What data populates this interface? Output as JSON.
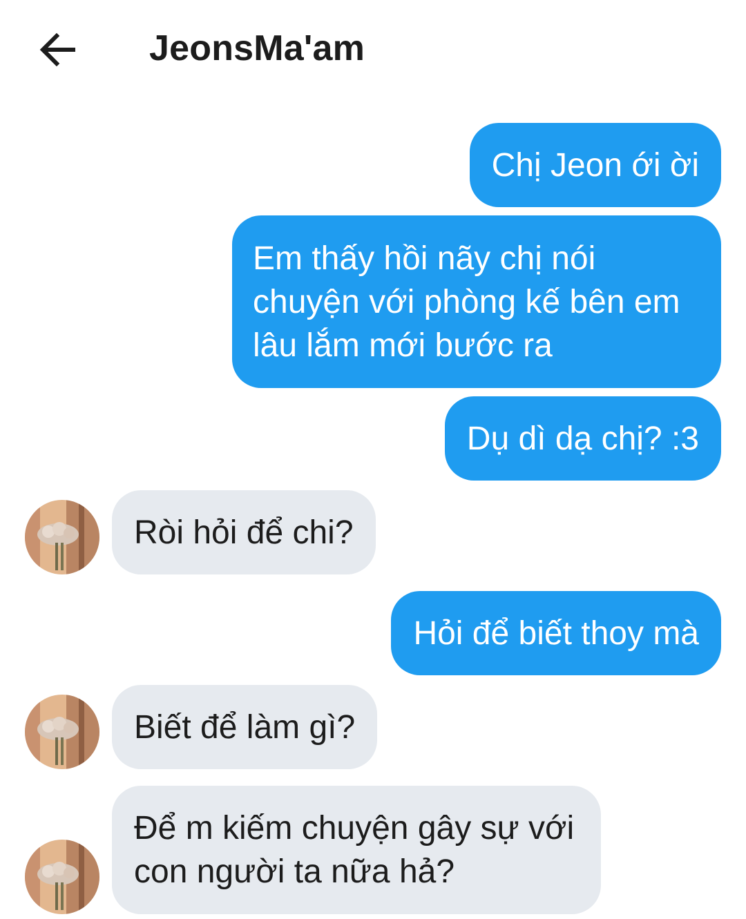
{
  "header": {
    "back_icon": "arrow-left-icon",
    "title": "JeonsMa'am"
  },
  "colors": {
    "outgoing_bubble": "#1f9cf0",
    "incoming_bubble": "#e6eaef",
    "background": "#ffffff"
  },
  "messages": [
    {
      "direction": "outgoing",
      "text": "Chị Jeon ới ời"
    },
    {
      "direction": "outgoing",
      "text": "Em thấy hồi nãy chị nói chuyện với phòng kế bên em lâu lắm mới bước ra"
    },
    {
      "direction": "outgoing",
      "text": "Dụ dì dạ chị? :3"
    },
    {
      "direction": "incoming",
      "text": "Ròi hỏi để chi?"
    },
    {
      "direction": "outgoing",
      "text": "Hỏi để biết thoy mà"
    },
    {
      "direction": "incoming",
      "text": "Biết để làm gì?"
    },
    {
      "direction": "incoming",
      "text": "Để m kiếm chuyện gây sự với con người ta nữa hả?"
    }
  ],
  "avatar_icon": "flower-bouquet-avatar-icon"
}
